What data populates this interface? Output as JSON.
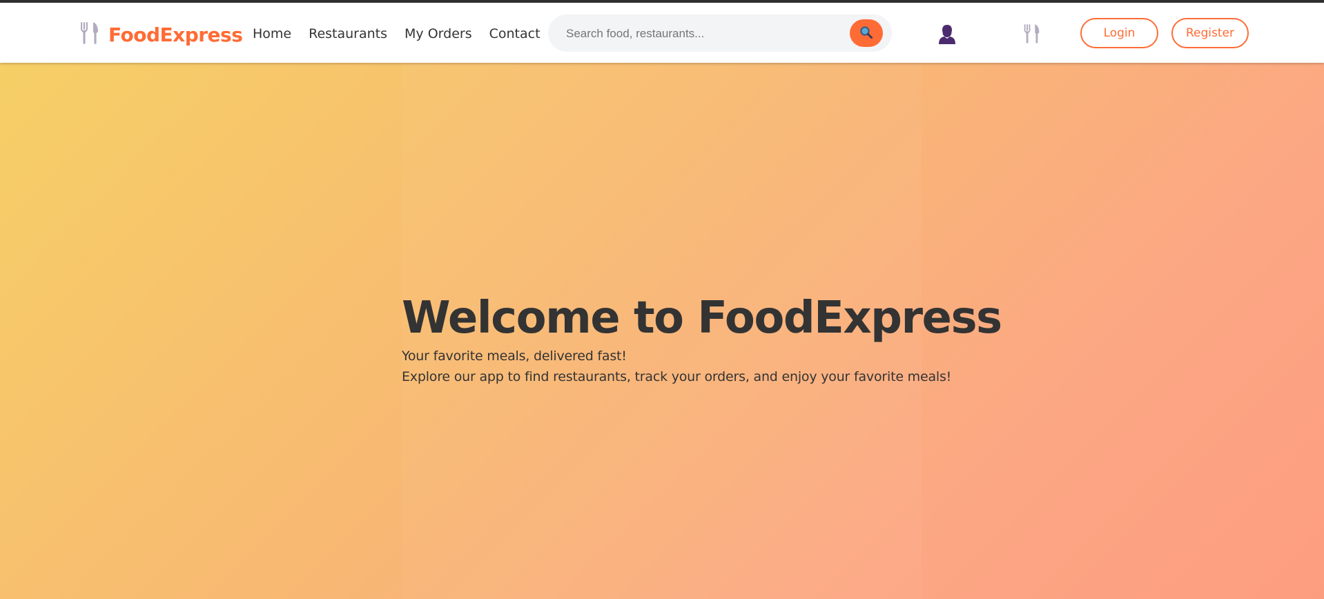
{
  "brand": {
    "name": "FoodExpress",
    "icon": "cutlery-icon",
    "color": "#ff6b35"
  },
  "nav": {
    "links": [
      {
        "label": "Home"
      },
      {
        "label": "Restaurants"
      },
      {
        "label": "My Orders"
      },
      {
        "label": "Contact"
      }
    ]
  },
  "search": {
    "placeholder": "Search food, restaurants...",
    "value": "",
    "button_icon": "search-icon"
  },
  "icons": {
    "user": "user-icon",
    "menu": "cutlery-icon"
  },
  "auth": {
    "login_label": "Login",
    "register_label": "Register"
  },
  "hero": {
    "title": "Welcome to FoodExpress",
    "tagline": "Your favorite meals, delivered fast!",
    "description": "Explore our app to find restaurants, track your orders, and enjoy your favorite meals!"
  },
  "colors": {
    "accent": "#ff6b35",
    "text": "#333333",
    "hero_gradient_start": "#f6cf66",
    "hero_gradient_end": "#fd9d80"
  }
}
